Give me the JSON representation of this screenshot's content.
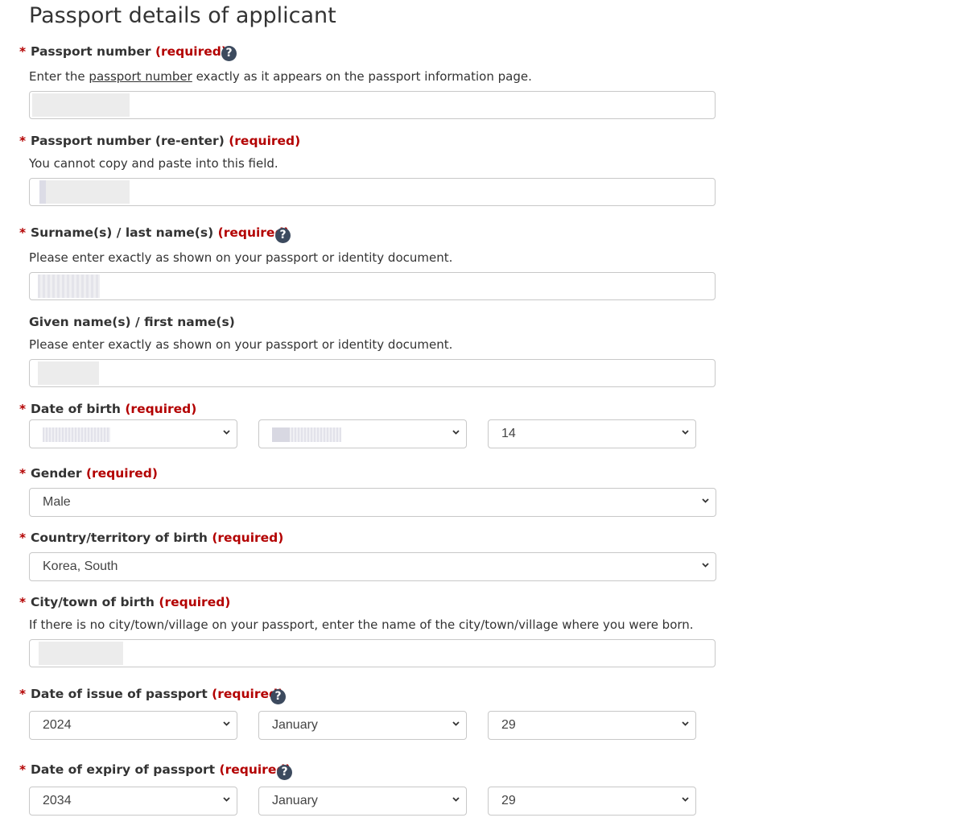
{
  "page": {
    "title": "Passport details of applicant"
  },
  "required_marker": "*",
  "required_text": "(required)",
  "help_glyph": "?",
  "fields": {
    "passport_number": {
      "label": "Passport number",
      "hint_before": "Enter the ",
      "hint_link": "passport number",
      "hint_after": " exactly as it appears on the passport information page."
    },
    "passport_reenter": {
      "label": "Passport number (re-enter)",
      "hint": "You cannot copy and paste into this field."
    },
    "surname": {
      "label": "Surname(s) / last name(s)",
      "hint": "Please enter exactly as shown on your passport or identity document."
    },
    "given_names": {
      "label": "Given name(s) / first name(s)",
      "hint": "Please enter exactly as shown on your passport or identity document."
    },
    "dob": {
      "label": "Date of birth",
      "year": "",
      "month": "",
      "day": "14"
    },
    "gender": {
      "label": "Gender",
      "value": "Male"
    },
    "country_birth": {
      "label": "Country/territory of birth",
      "value": "Korea, South"
    },
    "city_birth": {
      "label": "City/town of birth",
      "hint": "If there is no city/town/village on your passport, enter the name of the city/town/village where you were born."
    },
    "issue_date": {
      "label": "Date of issue of passport",
      "year": "2024",
      "month": "January",
      "day": "29"
    },
    "expiry_date": {
      "label": "Date of expiry of passport",
      "year": "2034",
      "month": "January",
      "day": "29"
    }
  },
  "colors": {
    "required": "#b30000",
    "help_icon": "#3c4a5e",
    "border": "#c8c8c8"
  }
}
